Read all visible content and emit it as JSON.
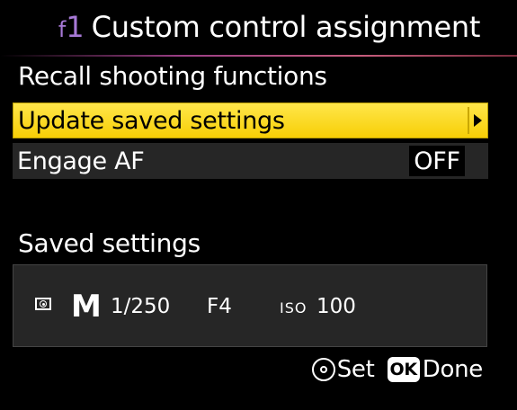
{
  "header": {
    "code_letter": "f",
    "code_number": "1",
    "title": "Custom control assignment"
  },
  "section": {
    "title": "Recall shooting functions"
  },
  "menu": [
    {
      "label": "Update saved settings"
    },
    {
      "label": "Engage AF",
      "value": "OFF"
    }
  ],
  "saved": {
    "title": "Saved settings",
    "metering_icon": "matrix-metering-icon",
    "mode": "M",
    "shutter": "1/250",
    "aperture": "F4",
    "iso_label": "ISO",
    "iso_value": "100"
  },
  "footer": {
    "set_icon": "multi-selector-icon",
    "set_label": "Set",
    "ok_badge": "OK",
    "done_label": "Done"
  },
  "colors": {
    "highlight": "#f7cf06",
    "accent": "#a779d6",
    "row_bg": "#262626"
  }
}
